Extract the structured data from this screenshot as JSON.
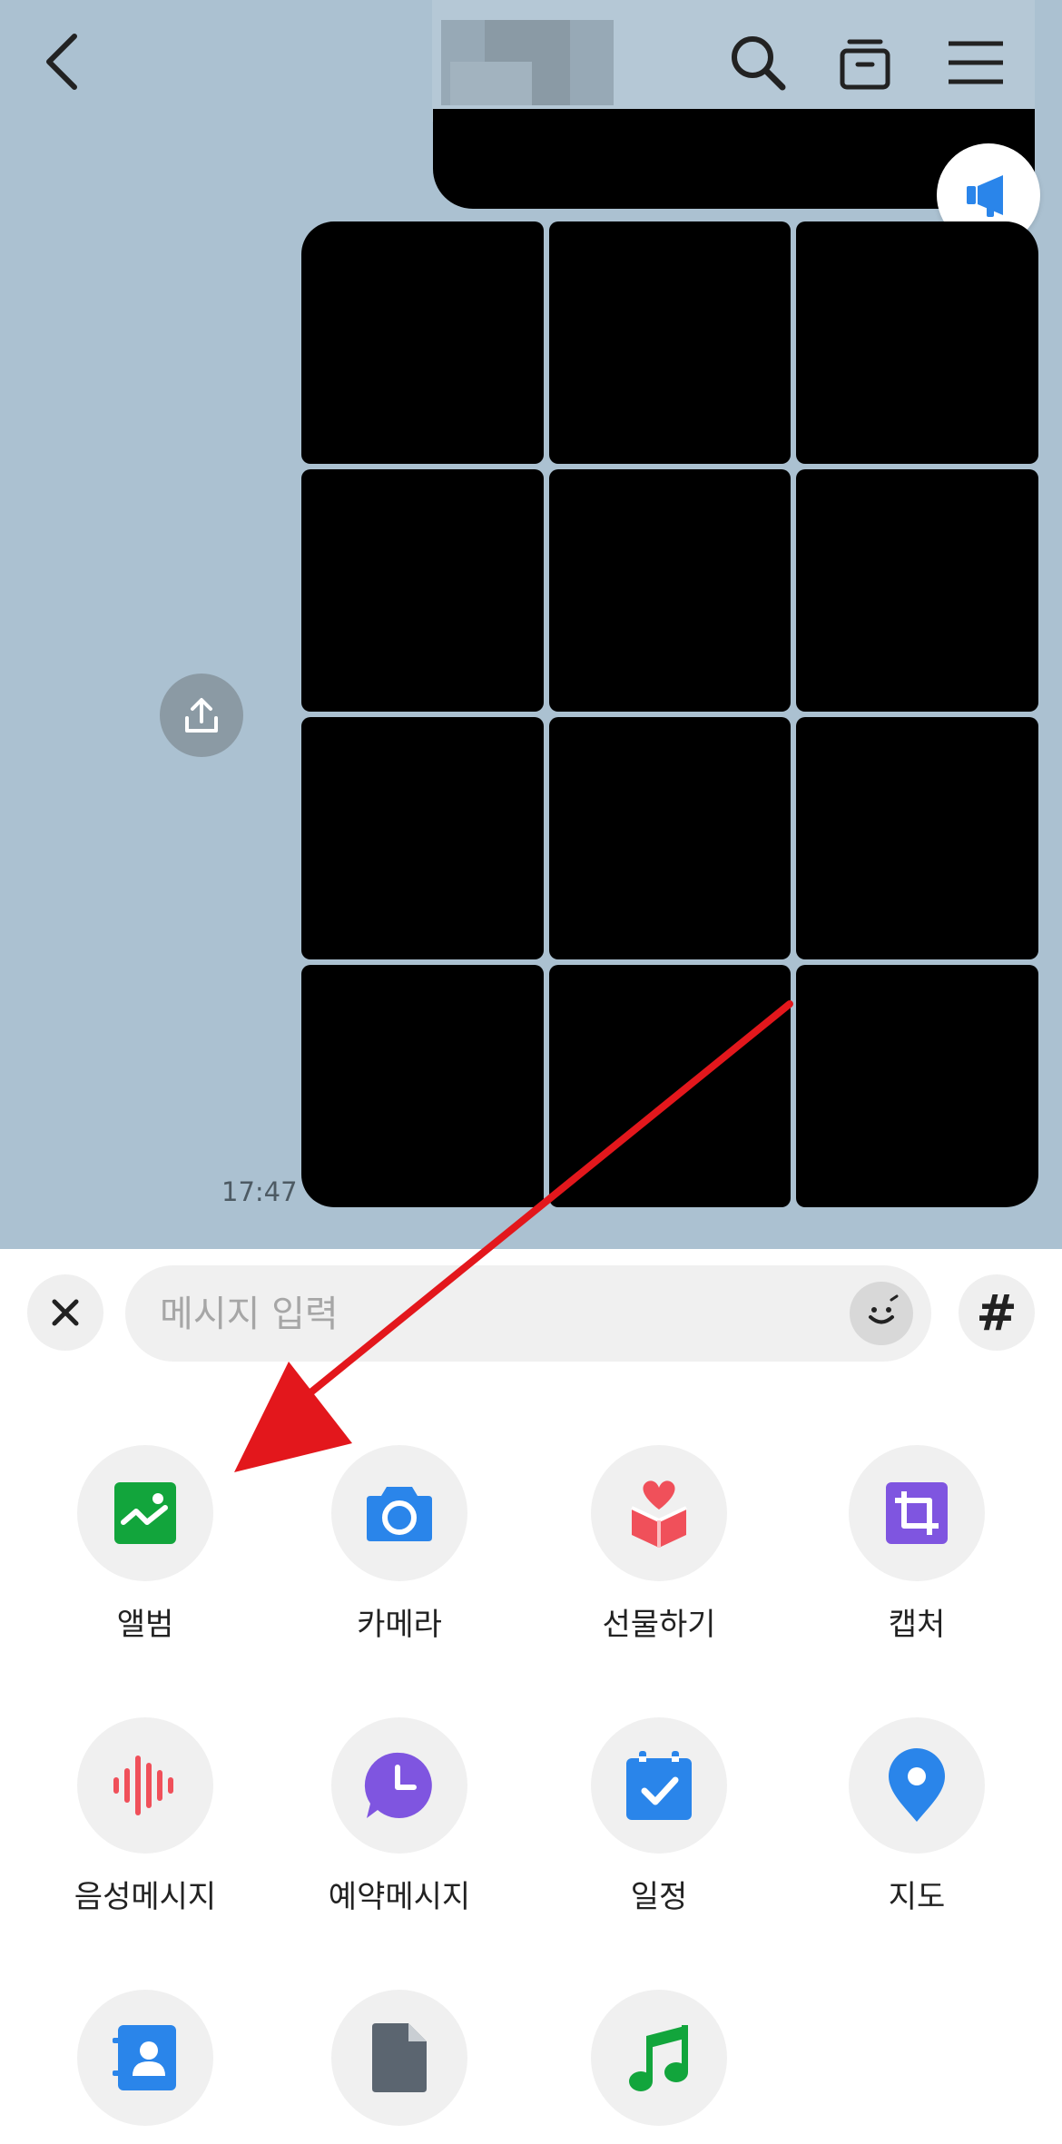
{
  "chat": {
    "timestamp": "17:47"
  },
  "input": {
    "placeholder": "메시지 입력"
  },
  "menu": {
    "items": [
      {
        "label": "앨범",
        "icon": "album-icon",
        "color": "#12a53c"
      },
      {
        "label": "카메라",
        "icon": "camera-icon",
        "color": "#2a85ea"
      },
      {
        "label": "선물하기",
        "icon": "gift-icon",
        "color": "#f0505a"
      },
      {
        "label": "캡처",
        "icon": "capture-icon",
        "color": "#7f55e0"
      },
      {
        "label": "음성메시지",
        "icon": "voice-message-icon",
        "color": "#f0505a"
      },
      {
        "label": "예약메시지",
        "icon": "scheduled-message-icon",
        "color": "#7f55e0"
      },
      {
        "label": "일정",
        "icon": "calendar-icon",
        "color": "#2a85ea"
      },
      {
        "label": "지도",
        "icon": "map-pin-icon",
        "color": "#2a85ea"
      },
      {
        "label": "",
        "icon": "contact-icon",
        "color": "#2a85ea"
      },
      {
        "label": "",
        "icon": "file-icon",
        "color": "#5b6570"
      },
      {
        "label": "",
        "icon": "music-icon",
        "color": "#12a53c"
      }
    ]
  },
  "annotation": {
    "arrow_color": "#e3171c"
  }
}
